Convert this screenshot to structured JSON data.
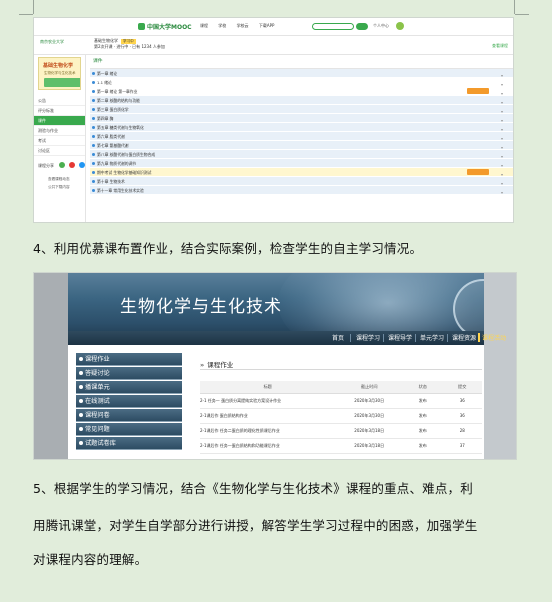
{
  "shot1": {
    "logo": "中国大学MOOC",
    "nav": [
      "课程",
      "学校",
      "学校云",
      "下载APP"
    ],
    "user": "个人中心",
    "school": "南京农业大学",
    "course_name": "基础生物化学",
    "course_meta": "第2次开课 · 进行中 · 已有 1234 人参加",
    "tag": "学习中",
    "right_link": "查看课程",
    "cover_title": "基础生物化学",
    "cover_sub": "生物化学与生化技术",
    "menu": [
      "公告",
      "评分标准",
      "课件",
      "测验与作业",
      "考试",
      "讨论区"
    ],
    "active_menu": "课件",
    "share_label": "课程分享",
    "mini_items": [
      "查看课程动态",
      "公共下载内容"
    ],
    "main_title": "课件",
    "rows": [
      {
        "text": "第一章 绪论",
        "kind": "ch"
      },
      {
        "text": "1.1 绪论",
        "kind": "sub"
      },
      {
        "text": "第一章 绪论 第一章作业",
        "kind": "sub",
        "btn": true
      },
      {
        "text": "第二章 核酸的结构与功能",
        "kind": "ch"
      },
      {
        "text": "第三章 蛋白质化学",
        "kind": "ch"
      },
      {
        "text": "第四章 酶",
        "kind": "ch"
      },
      {
        "text": "第五章 糖类代谢与生物氧化",
        "kind": "ch"
      },
      {
        "text": "第六章 脂类代谢",
        "kind": "ch"
      },
      {
        "text": "第七章 氨基酸代谢",
        "kind": "ch"
      },
      {
        "text": "第八章 核酸代谢与蛋白质生物合成",
        "kind": "ch"
      },
      {
        "text": "第九章 物质代谢的调节",
        "kind": "ch"
      },
      {
        "text": "期中考试 生物化学基础知识测试",
        "kind": "hl",
        "btn": true
      },
      {
        "text": "第十章 生物技术",
        "kind": "ch"
      },
      {
        "text": "第十一章 常用生化技术实验",
        "kind": "ch"
      }
    ]
  },
  "para4": "4、利用优慕课布置作业，结合实际案例，检查学生的自主学习情况。",
  "shot2": {
    "title": "生物化学与生化技术",
    "nav": [
      "首页",
      "课程学习",
      "课程导学",
      "单元学习",
      "课程资源",
      "课程活动"
    ],
    "active_nav": "课程活动",
    "menu": [
      "课程作业",
      "答疑讨论",
      "播课单元",
      "在线测试",
      "课程问卷",
      "常见问题",
      "试题试卷库"
    ],
    "section": "课程作业",
    "columns": [
      "标题",
      "截止时间",
      "状态",
      "提交"
    ],
    "rows": [
      {
        "title": "2-1 任务一 蛋白质分离提纯实验方案设计作业",
        "date": "2020年3月30日",
        "status": "发布",
        "count": "36"
      },
      {
        "title": "2-1课后作 蛋白质结构作业",
        "date": "2020年3月30日",
        "status": "发布",
        "count": "36"
      },
      {
        "title": "2-1课后作 任务二蛋白质的理化性质课后作业",
        "date": "2020年3月18日",
        "status": "发布",
        "count": "28"
      },
      {
        "title": "2-1课后作 任务一蛋白质结构和功能课后作业",
        "date": "2020年3月18日",
        "status": "发布",
        "count": "37"
      }
    ]
  },
  "para5_line1": "5、根据学生的学习情况，结合《生物化学与生化技术》课程的重点、难点，利",
  "para5_line2": "用腾讯课堂，对学生自学部分进行讲授，解答学生学习过程中的困惑，加强学生",
  "para5_line3": "对课程内容的理解。"
}
